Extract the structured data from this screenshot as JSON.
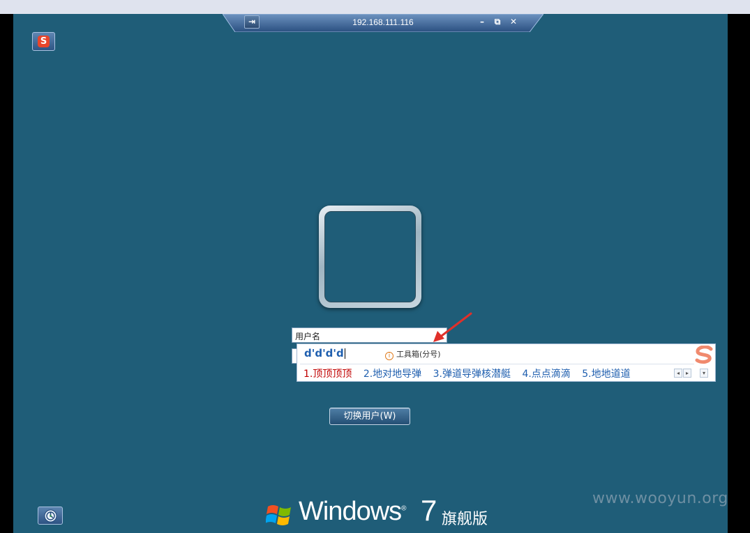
{
  "rdp": {
    "pin_glyph": "⇥",
    "host": "192.168.111.116",
    "minimize": "–",
    "restore": "⧉",
    "close": "✕"
  },
  "sogou": {
    "logo_text": "S"
  },
  "login": {
    "username_placeholder": "用户名",
    "switch_user_label": "切换用户(W)"
  },
  "ime": {
    "composition": "d'd'd'd",
    "toolbox_label": "工具箱(分号)",
    "candidates": [
      "1.顶顶顶顶",
      "2.地对地导弹",
      "3.弹道导弹核潜艇",
      "4.点点滴滴",
      "5.地地道道"
    ],
    "prev_glyph": "◂",
    "next_glyph": "▸",
    "expand_glyph": "▾"
  },
  "branding": {
    "windows": "Windows",
    "version": "7",
    "edition": "旗舰版",
    "registered": "®"
  },
  "watermark": "www.wooyun.org",
  "colors": {
    "desktop_bg": "#1f5d78",
    "candidate_highlight": "#c00000",
    "candidate_text": "#1f5faf",
    "arrow": "#e0302a"
  },
  "icons": {
    "rdp_pin": "pin-icon",
    "ease_of_access": "ease-of-access-icon",
    "windows_logo": "windows-flag-icon",
    "sogou": "sogou-ime-icon",
    "info": "info-icon"
  }
}
